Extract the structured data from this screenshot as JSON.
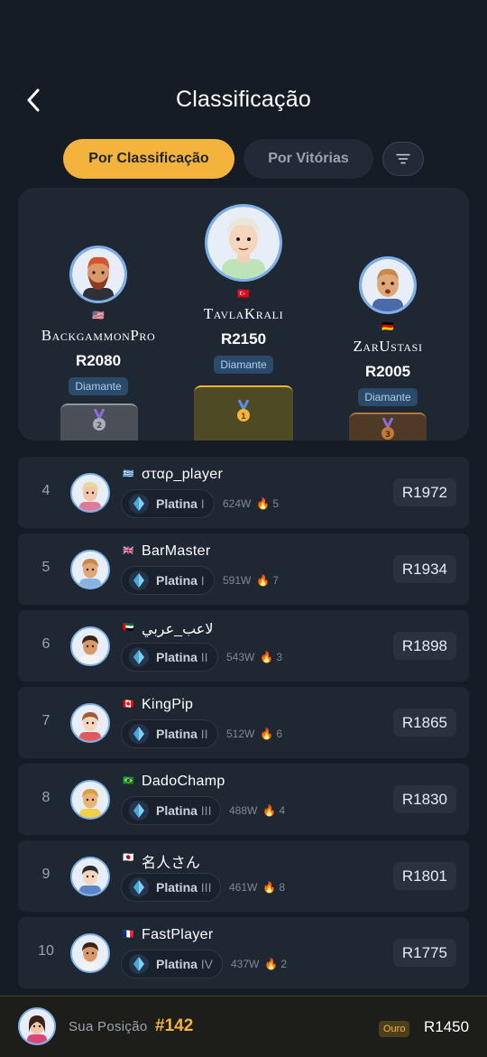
{
  "header": {
    "title": "Classificação",
    "back_icon": "chevron-left-icon"
  },
  "tabs": [
    {
      "label": "Por Classificação",
      "active": true
    },
    {
      "label": "Por Vitórias",
      "active": false
    }
  ],
  "filter_icon": "filter-icon",
  "podium": {
    "first": {
      "name": "TavlaKrali",
      "flag": "🇹🇷",
      "rating": "R2150",
      "tier": "Diamante",
      "medal": "1"
    },
    "second": {
      "name": "BackgammonPro",
      "flag": "🇺🇸",
      "rating": "R2080",
      "tier": "Diamante",
      "medal": "2"
    },
    "third": {
      "name": "ZarUstasi",
      "flag": "🇩🇪",
      "rating": "R2005",
      "tier": "Diamante",
      "medal": "3"
    }
  },
  "players": [
    {
      "rank": "4",
      "flag": "🇬🇷",
      "name": "σταρ_player",
      "tier": "Platina",
      "level": "I",
      "wins": "624W",
      "streak": "5",
      "rating": "R1972"
    },
    {
      "rank": "5",
      "flag": "🇬🇧",
      "name": "BarMaster",
      "tier": "Platina",
      "level": "I",
      "wins": "591W",
      "streak": "7",
      "rating": "R1934"
    },
    {
      "rank": "6",
      "flag": "🇦🇪",
      "name": "لاعب_عربي",
      "tier": "Platina",
      "level": "II",
      "wins": "543W",
      "streak": "3",
      "rating": "R1898"
    },
    {
      "rank": "7",
      "flag": "🇨🇦",
      "name": "KingPip",
      "tier": "Platina",
      "level": "II",
      "wins": "512W",
      "streak": "6",
      "rating": "R1865"
    },
    {
      "rank": "8",
      "flag": "🇧🇷",
      "name": "DadoChamp",
      "tier": "Platina",
      "level": "III",
      "wins": "488W",
      "streak": "4",
      "rating": "R1830"
    },
    {
      "rank": "9",
      "flag": "🇯🇵",
      "name": "名人さん",
      "tier": "Platina",
      "level": "III",
      "wins": "461W",
      "streak": "8",
      "rating": "R1801"
    },
    {
      "rank": "10",
      "flag": "🇫🇷",
      "name": "FastPlayer",
      "tier": "Platina",
      "level": "IV",
      "wins": "437W",
      "streak": "2",
      "rating": "R1775"
    }
  ],
  "me": {
    "label": "Sua Posição",
    "position": "#142",
    "tier": "Ouro",
    "rating": "R1450"
  },
  "colors": {
    "accent": "#f3b33d",
    "background": "#151c26",
    "card": "#1f2733",
    "avatar_ring": "#7db0e8"
  }
}
